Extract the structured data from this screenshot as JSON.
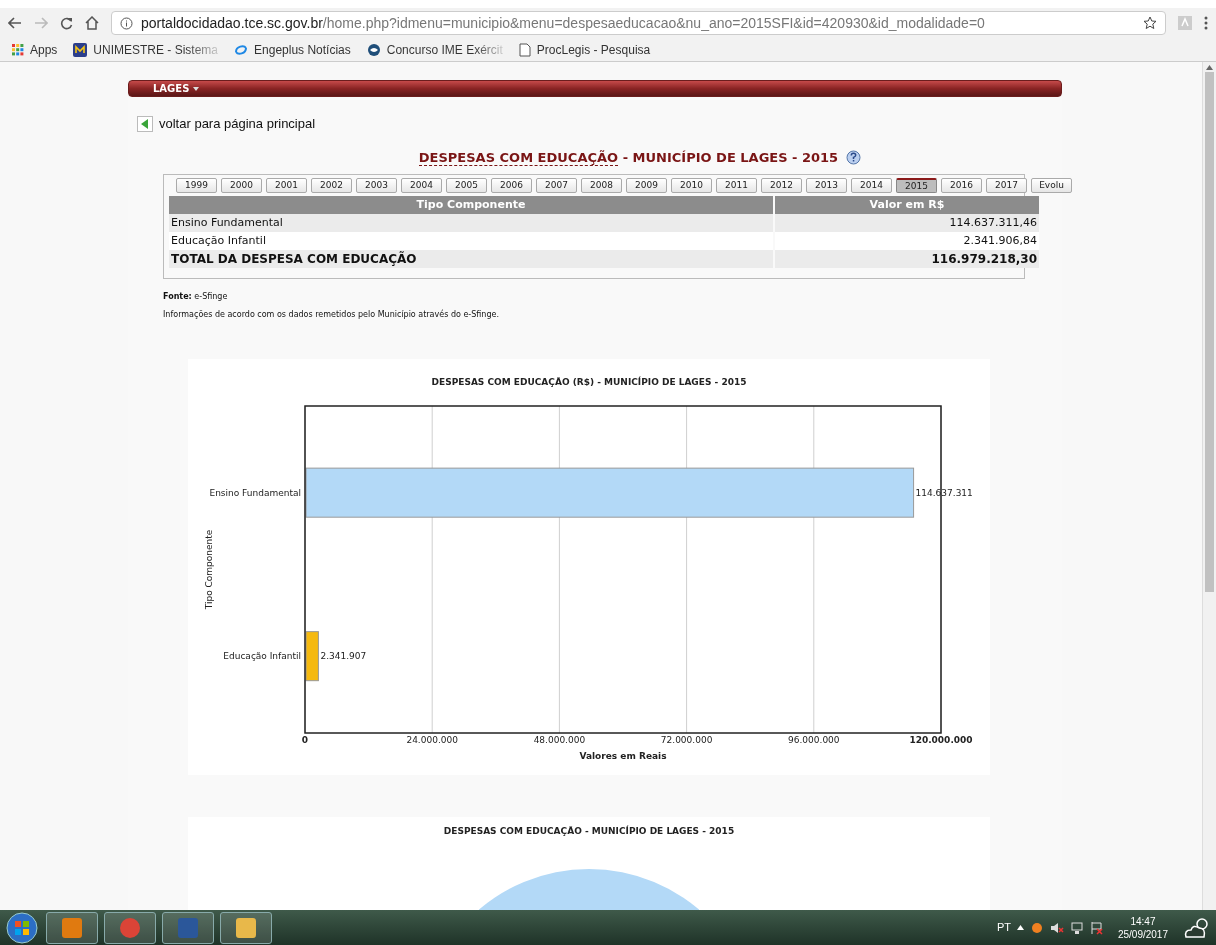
{
  "browser": {
    "url_host": "portaldocidadao.tce.sc.gov.br",
    "url_path": "/home.php?idmenu=municipio&menu=despesaeducacao&nu_ano=2015SFI&id=420930&id_modalidade=0",
    "bookmarks": [
      {
        "label": "Apps",
        "truncated": false
      },
      {
        "label": "UNIMESTRE - Sistema",
        "truncated": true
      },
      {
        "label": "Engeplus Notícias",
        "truncated": false
      },
      {
        "label": "Concurso IME Exércit",
        "truncated": true
      },
      {
        "label": "ProcLegis - Pesquisa",
        "truncated": false
      }
    ]
  },
  "menu_bar": {
    "label": "LAGES"
  },
  "back_link": "voltar para página principal",
  "heading": {
    "underlined": "DESPESAS COM EDUCAÇÃO",
    "rest": " - MUNICÍPIO DE LAGES - 2015"
  },
  "year_tabs": [
    {
      "label": "1999",
      "selected": false
    },
    {
      "label": "2000",
      "selected": false
    },
    {
      "label": "2001",
      "selected": false
    },
    {
      "label": "2002",
      "selected": false
    },
    {
      "label": "2003",
      "selected": false
    },
    {
      "label": "2004",
      "selected": false
    },
    {
      "label": "2005",
      "selected": false
    },
    {
      "label": "2006",
      "selected": false
    },
    {
      "label": "2007",
      "selected": false
    },
    {
      "label": "2008",
      "selected": false
    },
    {
      "label": "2009",
      "selected": false
    },
    {
      "label": "2010",
      "selected": false
    },
    {
      "label": "2011",
      "selected": false
    },
    {
      "label": "2012",
      "selected": false
    },
    {
      "label": "2013",
      "selected": false
    },
    {
      "label": "2014",
      "selected": false
    },
    {
      "label": "2015",
      "selected": true
    },
    {
      "label": "2016",
      "selected": false
    },
    {
      "label": "2017",
      "selected": false
    },
    {
      "label": "Evolu",
      "selected": false
    }
  ],
  "table": {
    "columns": [
      "Tipo Componente",
      "Valor em R$"
    ],
    "rows": [
      {
        "kind": "item",
        "cells": [
          "Ensino Fundamental",
          "114.637.311,46"
        ]
      },
      {
        "kind": "item",
        "cells": [
          "Educação Infantil",
          "2.341.906,84"
        ]
      },
      {
        "kind": "total",
        "cells": [
          "TOTAL DA DESPESA COM EDUCAÇÃO",
          "116.979.218,30"
        ]
      }
    ]
  },
  "source": "**Fonte:** e-Sfinge",
  "note": "Informações de acordo com os dados remetidos pelo Município através do e-Sfinge.",
  "bar_chart": {
    "chart_data": {
      "type": "bar",
      "orientation": "horizontal",
      "title": "DESPESAS COM EDUCAÇÃO (R$) - MUNICÍPIO DE LAGES - 2015",
      "xlabel": "Valores em Reais",
      "ylabel": "Tipo Componente",
      "categories": [
        "Ensino Fundamental",
        "Educação Infantil"
      ],
      "series": [
        {
          "color": "#b3d9f7",
          "values": [
            114637311,
            null
          ]
        },
        {
          "color": "#f5b90f",
          "values": [
            null,
            2341907
          ]
        }
      ],
      "grid": true,
      "xlim": [
        0,
        120000000
      ],
      "xticks": [
        {
          "value": 0,
          "label": "0"
        },
        {
          "value": 24000000,
          "label": "24.000.000"
        },
        {
          "value": 48000000,
          "label": "48.000.000"
        },
        {
          "value": 72000000,
          "label": "72.000.000"
        },
        {
          "value": 96000000,
          "label": "96.000.000"
        },
        {
          "value": 120000000,
          "label": "120.000.000"
        }
      ],
      "value_labels": [
        "114.637.311",
        "2.341.907"
      ]
    }
  },
  "pie_chart": {
    "title": "DESPESAS COM EDUCAÇÃO - MUNICÍPIO DE LAGES - 2015"
  },
  "taskbar": {
    "language": "PT",
    "time": "14:47",
    "date": "25/09/2017"
  }
}
